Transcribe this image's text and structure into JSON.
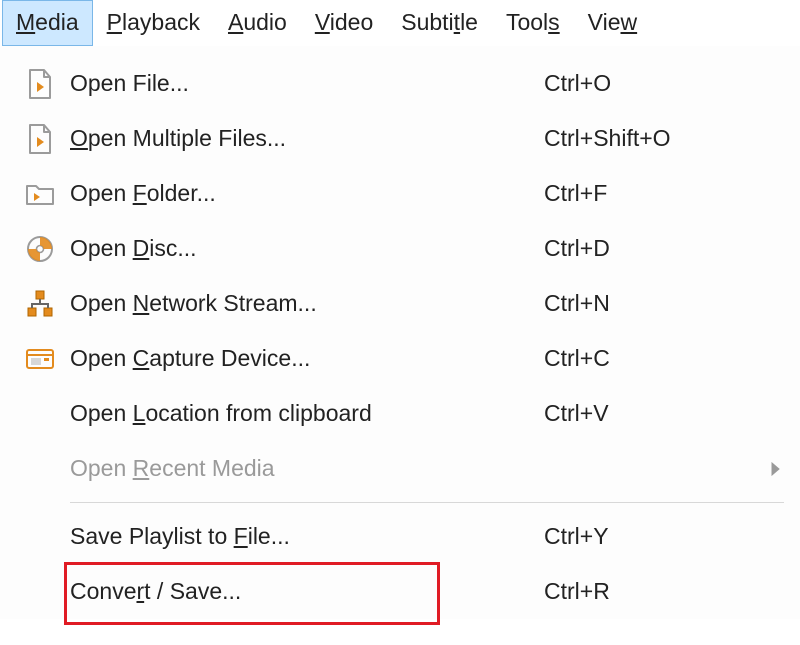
{
  "menubar": {
    "items": [
      {
        "pre": "",
        "mn": "M",
        "post": "edia",
        "active": true,
        "name": "menu-media"
      },
      {
        "pre": "",
        "mn": "P",
        "post": "layback",
        "active": false,
        "name": "menu-playback"
      },
      {
        "pre": "",
        "mn": "A",
        "post": "udio",
        "active": false,
        "name": "menu-audio"
      },
      {
        "pre": "",
        "mn": "V",
        "post": "ideo",
        "active": false,
        "name": "menu-video"
      },
      {
        "pre": "Subti",
        "mn": "t",
        "post": "le",
        "active": false,
        "name": "menu-subtitle"
      },
      {
        "pre": "Tool",
        "mn": "s",
        "post": "",
        "active": false,
        "name": "menu-tools"
      },
      {
        "pre": "Vie",
        "mn": "w",
        "post": "",
        "active": false,
        "name": "menu-view-cut"
      }
    ]
  },
  "dropdown": {
    "entries": [
      {
        "type": "item",
        "icon": "file-icon",
        "pre": "Open File...",
        "mn": "",
        "post": "",
        "shortcut": "Ctrl+O",
        "name": "open-file"
      },
      {
        "type": "item",
        "icon": "file-icon",
        "pre": "",
        "mn": "O",
        "post": "pen Multiple Files...",
        "shortcut": "Ctrl+Shift+O",
        "name": "open-multiple-files"
      },
      {
        "type": "item",
        "icon": "folder-icon",
        "pre": "Open ",
        "mn": "F",
        "post": "older...",
        "shortcut": "Ctrl+F",
        "name": "open-folder"
      },
      {
        "type": "item",
        "icon": "disc-icon",
        "pre": "Open ",
        "mn": "D",
        "post": "isc...",
        "shortcut": "Ctrl+D",
        "name": "open-disc"
      },
      {
        "type": "item",
        "icon": "network-icon",
        "pre": "Open ",
        "mn": "N",
        "post": "etwork Stream...",
        "shortcut": "Ctrl+N",
        "name": "open-network-stream"
      },
      {
        "type": "item",
        "icon": "capture-icon",
        "pre": "Open ",
        "mn": "C",
        "post": "apture Device...",
        "shortcut": "Ctrl+C",
        "name": "open-capture-device"
      },
      {
        "type": "item",
        "icon": "",
        "pre": "Open ",
        "mn": "L",
        "post": "ocation from clipboard",
        "shortcut": "Ctrl+V",
        "name": "open-location-clipboard"
      },
      {
        "type": "item",
        "icon": "",
        "pre": "Open ",
        "mn": "R",
        "post": "ecent Media",
        "shortcut": "",
        "name": "open-recent-media",
        "disabled": true,
        "submenu": true
      },
      {
        "type": "sep"
      },
      {
        "type": "item",
        "icon": "",
        "pre": "Save Playlist to ",
        "mn": "F",
        "post": "ile...",
        "shortcut": "Ctrl+Y",
        "name": "save-playlist-to-file"
      },
      {
        "type": "item",
        "icon": "",
        "pre": "Conve",
        "mn": "r",
        "post": "t / Save...",
        "shortcut": "Ctrl+R",
        "name": "convert-save",
        "highlighted": true
      }
    ]
  }
}
